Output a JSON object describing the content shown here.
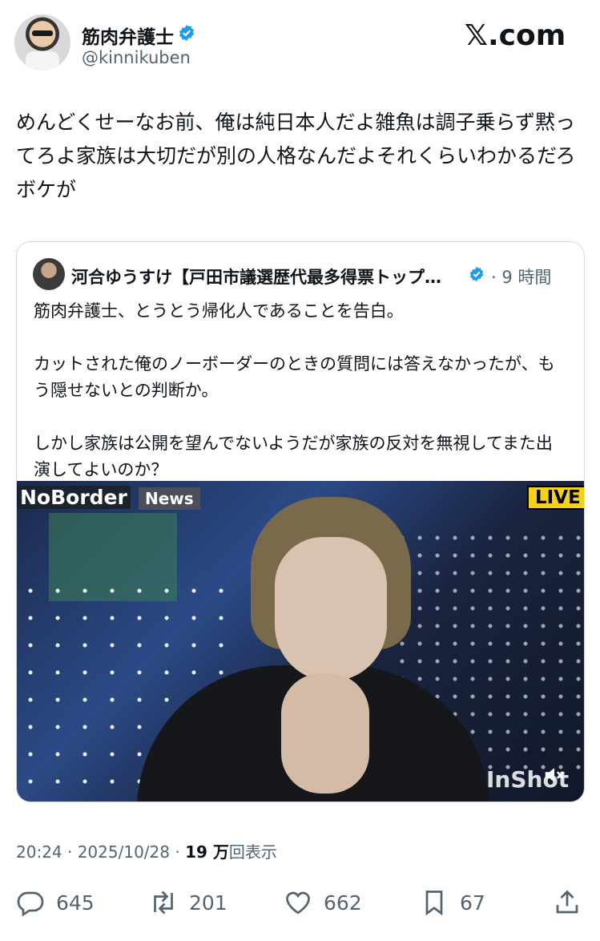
{
  "header": {
    "display_name": "筋肉弁護士",
    "handle": "@kinnikuben",
    "brand": "𝕏.com"
  },
  "tweet": {
    "text": "めんどくせーなお前、俺は純日本人だよ雑魚は調子乗らず黙ってろよ家族は大切だが別の人格なんだよそれくらいわかるだろボケが"
  },
  "quote": {
    "author": "河合ゆうすけ【戸田市議選歴代最多得票トップ…",
    "time": "· 9 時間",
    "text": "筋肉弁護士、とうとう帰化人であることを告白。\n\nカットされた俺のノーボーダーのときの質問には答えなかったが、もう隠せないとの判断か。\n\nしかし家族は公開を望んでないようだが家族の反対を無視してまた出演してよいのか？",
    "video": {
      "logo": "NoBorder",
      "news_tag": "News",
      "live_tag": "LIVE",
      "watermark": "InShot",
      "muted": true
    }
  },
  "meta": {
    "time": "20:24 · 2025/10/28 · ",
    "views_count": "19 万",
    "views_label": "回表示"
  },
  "actions": {
    "replies": "645",
    "reposts": "201",
    "likes": "662",
    "bookmarks": "67"
  },
  "colors": {
    "verified": "#1d9bf0",
    "secondary_text": "#536471",
    "border": "#cfd9de"
  }
}
